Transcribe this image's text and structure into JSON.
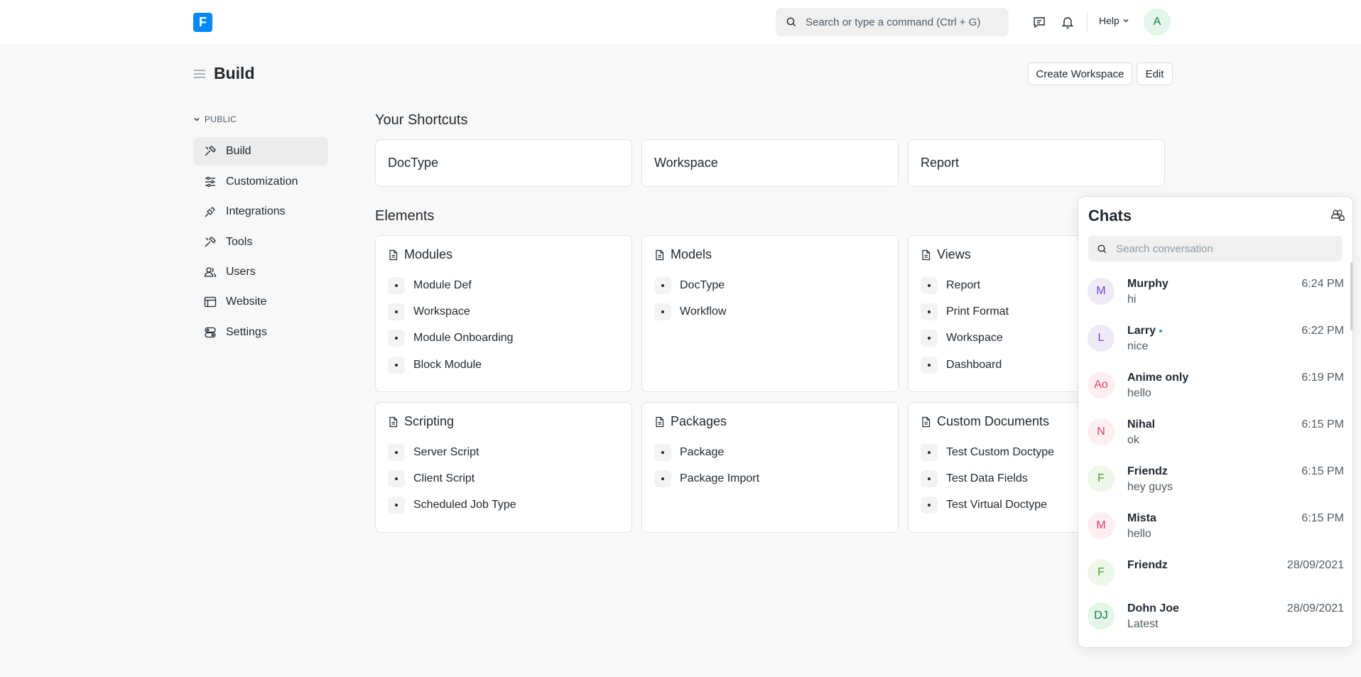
{
  "navbar": {
    "logo_letter": "F",
    "search_placeholder": "Search or type a command (Ctrl + G)",
    "help_label": "Help",
    "avatar_initial": "A"
  },
  "page": {
    "title": "Build",
    "create_workspace_label": "Create Workspace",
    "edit_label": "Edit"
  },
  "sidebar": {
    "section_label": "PUBLIC",
    "items": [
      {
        "label": "Build",
        "icon": "hammer-icon"
      },
      {
        "label": "Customization",
        "icon": "sliders-icon"
      },
      {
        "label": "Integrations",
        "icon": "plug-icon"
      },
      {
        "label": "Tools",
        "icon": "tools-icon"
      },
      {
        "label": "Users",
        "icon": "users-icon"
      },
      {
        "label": "Website",
        "icon": "browser-icon"
      },
      {
        "label": "Settings",
        "icon": "settings-icon"
      }
    ]
  },
  "shortcuts": {
    "title": "Your Shortcuts",
    "items": [
      "DocType",
      "Workspace",
      "Report"
    ]
  },
  "elements": {
    "title": "Elements",
    "cards": [
      {
        "title": "Modules",
        "links": [
          "Module Def",
          "Workspace",
          "Module Onboarding",
          "Block Module"
        ]
      },
      {
        "title": "Models",
        "links": [
          "DocType",
          "Workflow"
        ]
      },
      {
        "title": "Views",
        "links": [
          "Report",
          "Print Format",
          "Workspace",
          "Dashboard"
        ]
      },
      {
        "title": "Scripting",
        "links": [
          "Server Script",
          "Client Script",
          "Scheduled Job Type"
        ]
      },
      {
        "title": "Packages",
        "links": [
          "Package",
          "Package Import"
        ]
      },
      {
        "title": "Custom Documents",
        "links": [
          "Test Custom Doctype",
          "Test Data Fields",
          "Test Virtual Doctype"
        ]
      }
    ]
  },
  "chat": {
    "title": "Chats",
    "search_placeholder": "Search conversation",
    "conversations": [
      {
        "initials": "M",
        "name": "Murphy",
        "message": "hi",
        "time": "6:24 PM",
        "online": false,
        "bg": "#eeeaf8",
        "fg": "#6846e3"
      },
      {
        "initials": "L",
        "name": "Larry",
        "message": "nice",
        "time": "6:22 PM",
        "online": true,
        "bg": "#eeeaf8",
        "fg": "#6846e3"
      },
      {
        "initials": "Ao",
        "name": "Anime only",
        "message": "hello",
        "time": "6:19 PM",
        "online": false,
        "bg": "#fdeef2",
        "fg": "#e03e6b"
      },
      {
        "initials": "N",
        "name": "Nihal",
        "message": "ok",
        "time": "6:15 PM",
        "online": false,
        "bg": "#fdeef2",
        "fg": "#e03e6b"
      },
      {
        "initials": "F",
        "name": "Friendz",
        "message": "hey guys",
        "time": "6:15 PM",
        "online": false,
        "bg": "#eef8ea",
        "fg": "#4c9b2e"
      },
      {
        "initials": "M",
        "name": "Mista",
        "message": "hello",
        "time": "6:15 PM",
        "online": false,
        "bg": "#fdeef2",
        "fg": "#e03e6b"
      },
      {
        "initials": "F",
        "name": "Friendz",
        "message": "",
        "time": "28/09/2021",
        "online": false,
        "bg": "#eef8ea",
        "fg": "#4c9b2e"
      },
      {
        "initials": "DJ",
        "name": "Dohn Joe",
        "message": "Latest",
        "time": "28/09/2021",
        "online": false,
        "bg": "#e4f5e9",
        "fg": "#16794c"
      }
    ]
  }
}
